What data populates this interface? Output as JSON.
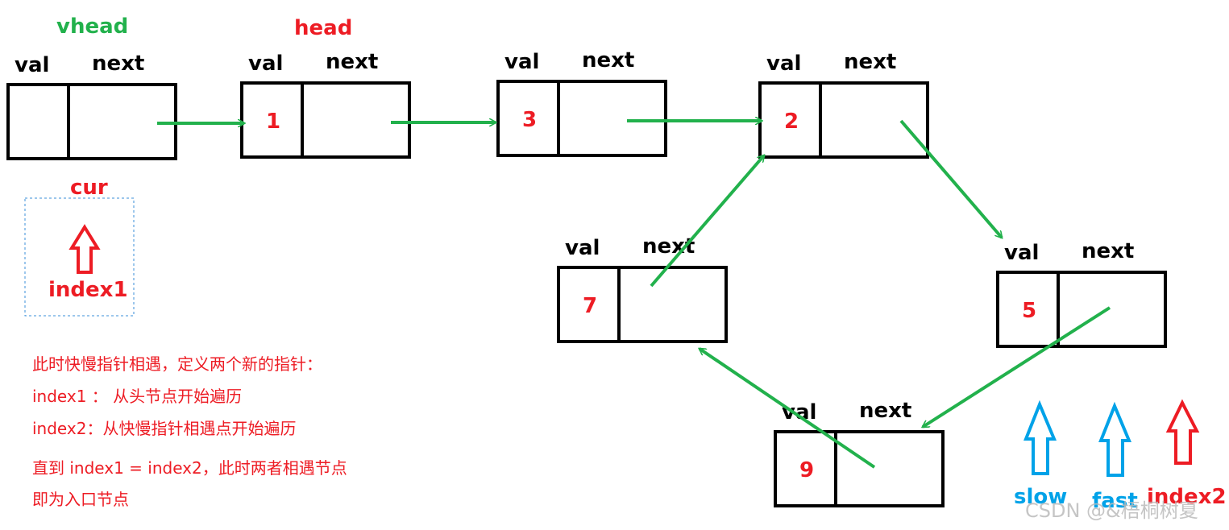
{
  "colors": {
    "arrow": "#22b14c",
    "red": "#ed1c24",
    "blue": "#00a2e8",
    "box": "#000000"
  },
  "field_labels": {
    "val": "val",
    "next": "next"
  },
  "pointers": {
    "vhead": "vhead",
    "head": "head",
    "cur": "cur",
    "index1": "index1",
    "slow": "slow",
    "fast": "fast",
    "index2": "index2"
  },
  "nodes": [
    {
      "id": "vhead",
      "value": ""
    },
    {
      "id": "n1",
      "value": "1"
    },
    {
      "id": "n3",
      "value": "3"
    },
    {
      "id": "n2",
      "value": "2"
    },
    {
      "id": "n5",
      "value": "5"
    },
    {
      "id": "n9",
      "value": "9"
    },
    {
      "id": "n7",
      "value": "7"
    }
  ],
  "edges": [
    [
      "vhead",
      "n1"
    ],
    [
      "n1",
      "n3"
    ],
    [
      "n3",
      "n2"
    ],
    [
      "n2",
      "n5"
    ],
    [
      "n5",
      "n9"
    ],
    [
      "n9",
      "n7"
    ],
    [
      "n7",
      "n2"
    ]
  ],
  "notes": [
    "此时快慢指针相遇，定义两个新的指针：",
    "index1 ： 从头节点开始遍历",
    "index2：从快慢指针相遇点开始遍历",
    "直到 index1 = index2，此时两者相遇节点",
    "即为入口节点"
  ],
  "watermark": "CSDN @&梧桐树夏"
}
